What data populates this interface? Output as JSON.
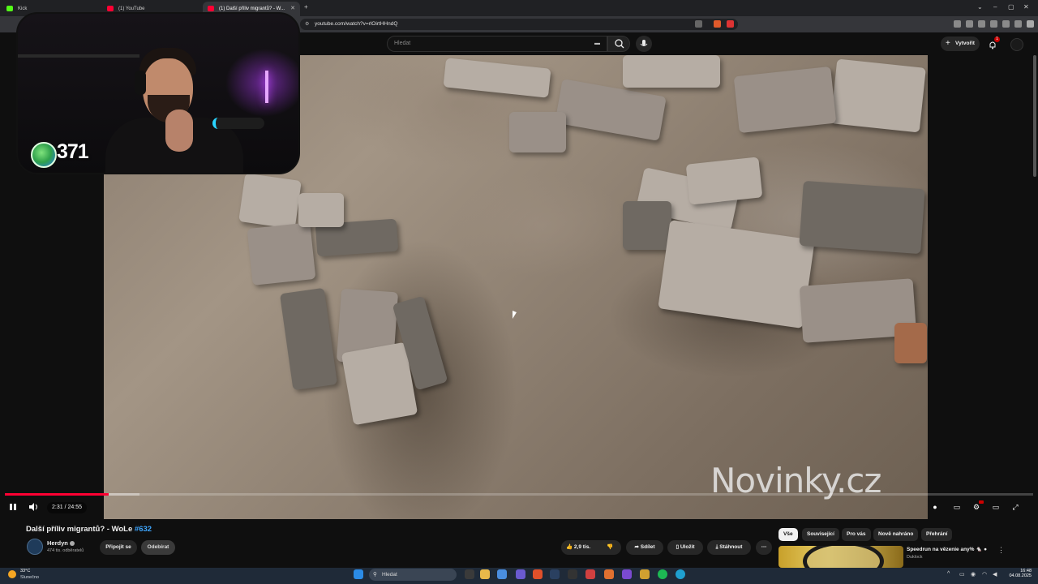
{
  "browser": {
    "tabs": [
      {
        "label": "Kick",
        "color": "#53fc18"
      },
      {
        "label": "(1) YouTube",
        "color": "#ff0033"
      },
      {
        "label": "(1) Další příliv migrantů? - W...",
        "color": "#ff0033"
      }
    ],
    "url": "youtube.com/watch?v=rlOirtHHndQ"
  },
  "youtube": {
    "search_placeholder": "Hledat",
    "create_label": "Vytvořit",
    "notifications_count": "1"
  },
  "webcam": {
    "viewer_count": "371"
  },
  "player": {
    "current_time": "2:31",
    "duration": "24:55",
    "time_display": "2:31 / 24:55",
    "progress": 0.101,
    "watermark": "Novinky.cz"
  },
  "video": {
    "title_prefix": "Další příliv migrantů? - WoLe ",
    "title_tag": "#632",
    "channel_name": "Herdyn",
    "subscribers": "474 tis. odběratelů",
    "join_label": "Připojit se",
    "subscribe_label": "Odebírat",
    "likes": "2,9 tis.",
    "share_label": "Sdílet",
    "save_label": "Uložit",
    "download_label": "Stáhnout"
  },
  "chips": [
    "Vše",
    "Související",
    "Pro vás",
    "Nově nahráno",
    "Přehrání"
  ],
  "recommendation": {
    "title": "Speedrun na vězenie any% 🐁 ●",
    "channel": "Duklock"
  },
  "taskbar": {
    "temperature": "33°C",
    "weather": "Slunečno",
    "search_placeholder": "Hledat",
    "time": "16:48",
    "date": "04.08.2025"
  }
}
